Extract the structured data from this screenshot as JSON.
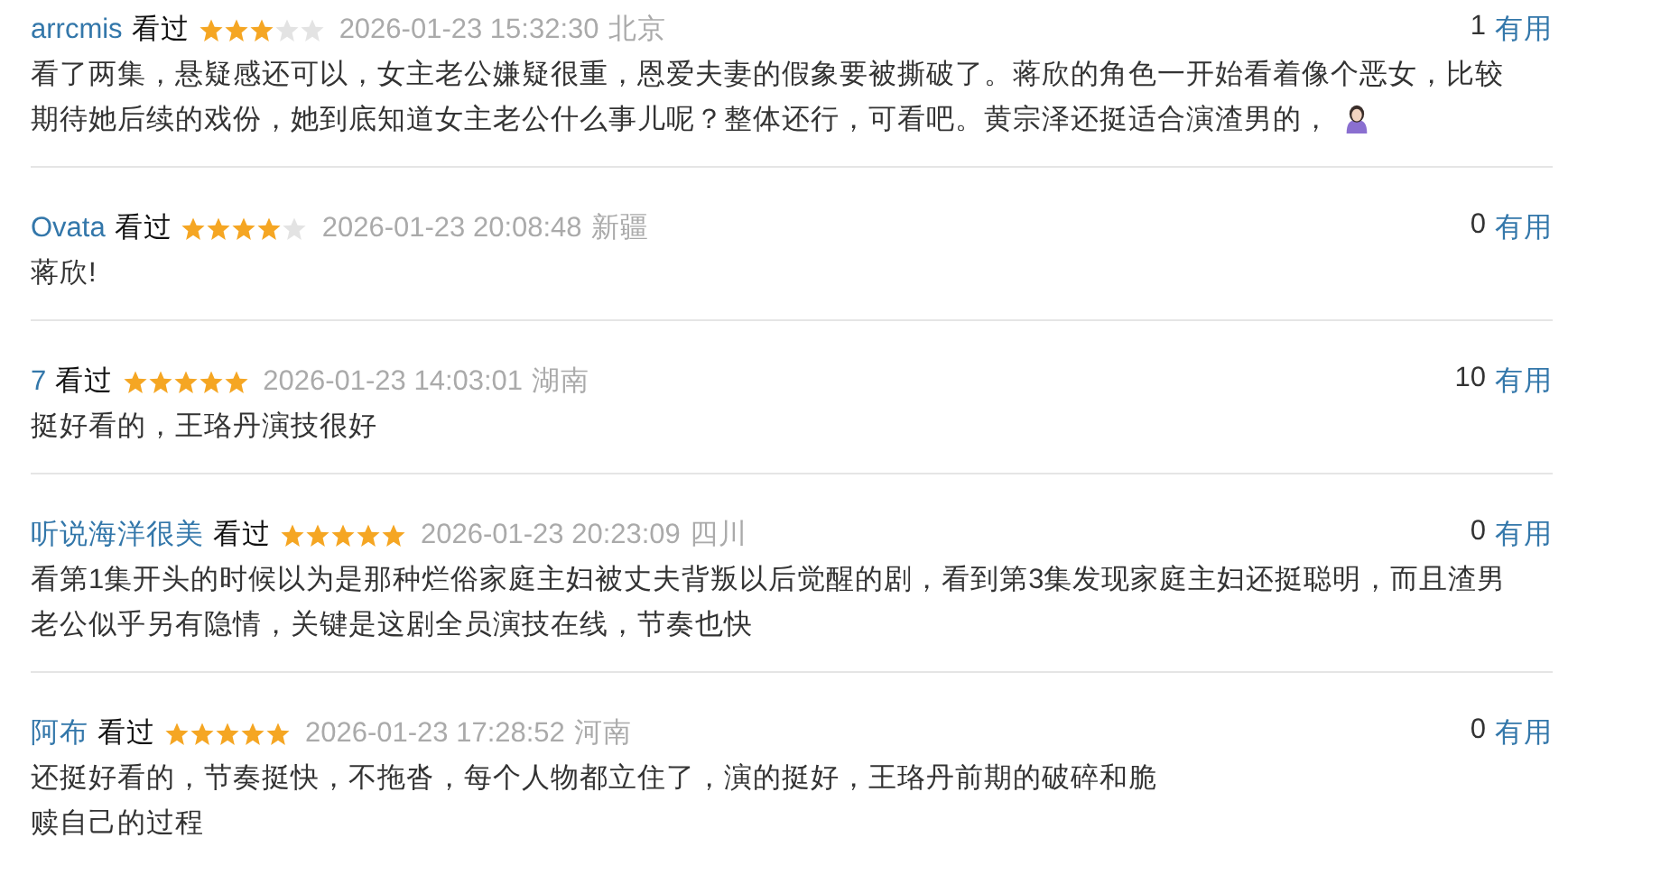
{
  "reviews": [
    {
      "user": "arrcmis",
      "status": "看过",
      "stars": 3,
      "time": "2026-01-23 15:32:30",
      "location": "北京",
      "useful_count": "1",
      "useful_label": "有用",
      "lines": [
        "看了两集，悬疑感还可以，女主老公嫌疑很重，恩爱夫妻的假象要被撕破了。蒋欣的角色一开始看着像个恶女，比较",
        "期待她后续的戏份，她到底知道女主老公什么事儿呢？整体还行，可看吧。黄宗泽还挺适合演渣男的，"
      ],
      "emoji": true
    },
    {
      "user": "Ovata",
      "status": "看过",
      "stars": 4,
      "time": "2026-01-23 20:08:48",
      "location": "新疆",
      "useful_count": "0",
      "useful_label": "有用",
      "lines": [
        "蒋欣!"
      ],
      "emoji": false
    },
    {
      "user": "7",
      "status": "看过",
      "stars": 5,
      "time": "2026-01-23 14:03:01",
      "location": "湖南",
      "useful_count": "10",
      "useful_label": "有用",
      "lines": [
        "挺好看的，王珞丹演技很好"
      ],
      "emoji": false
    },
    {
      "user": "听说海洋很美",
      "status": "看过",
      "stars": 5,
      "time": "2026-01-23 20:23:09",
      "location": "四川",
      "useful_count": "0",
      "useful_label": "有用",
      "lines": [
        "看第1集开头的时候以为是那种烂俗家庭主妇被丈夫背叛以后觉醒的剧，看到第3集发现家庭主妇还挺聪明，而且渣男",
        "老公似乎另有隐情，关键是这剧全员演技在线，节奏也快"
      ],
      "emoji": false
    },
    {
      "user": "阿布",
      "status": "看过",
      "stars": 5,
      "time": "2026-01-23 17:28:52",
      "location": "河南",
      "useful_count": "0",
      "useful_label": "有用",
      "lines": [
        "还挺好看的，节奏挺快，不拖沓，每个人物都立住了，演的挺好，王珞丹前期的破碎和脆",
        "赎自己的过程"
      ],
      "emoji": false
    }
  ]
}
